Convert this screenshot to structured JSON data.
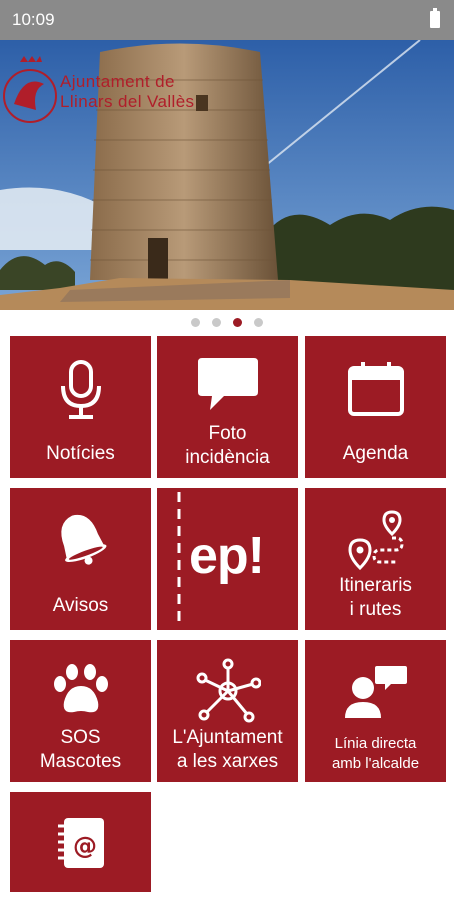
{
  "status_bar": {
    "time": "10:09"
  },
  "hero": {
    "logo_line1": "Ajuntament de",
    "logo_line2": "Llinars del Vallès",
    "active_slide": 3,
    "slide_count": 4
  },
  "tiles": [
    {
      "lines": [
        "Notícies"
      ],
      "icon": "microphone-icon"
    },
    {
      "lines": [
        "Foto",
        "incidència"
      ],
      "icon": "speech-bubble-icon"
    },
    {
      "lines": [
        "Agenda"
      ],
      "icon": "calendar-icon"
    },
    {
      "lines": [
        "Avisos"
      ],
      "icon": "bell-icon"
    },
    {
      "lines": [],
      "icon": "ep-logo-icon",
      "logo_text": "ep!"
    },
    {
      "lines": [
        "Itineraris",
        "i rutes"
      ],
      "icon": "route-map-icon"
    },
    {
      "lines": [
        "SOS",
        "Mascotes"
      ],
      "icon": "paw-icon"
    },
    {
      "lines": [
        "L'Ajuntament",
        "a les xarxes"
      ],
      "icon": "network-icon"
    },
    {
      "lines": [
        "Línia directa",
        "amb l'alcalde"
      ],
      "icon": "chat-person-icon"
    },
    {
      "lines": [],
      "icon": "contacts-book-icon"
    }
  ],
  "colors": {
    "brand": "#9c1b24",
    "status_bar": "#8a8a8a"
  }
}
